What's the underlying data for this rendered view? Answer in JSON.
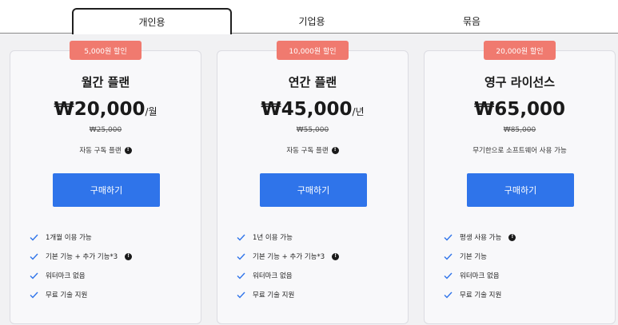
{
  "tabs": [
    {
      "label": "개인용",
      "active": true
    },
    {
      "label": "기업용",
      "active": false
    },
    {
      "label": "묶음",
      "active": false
    }
  ],
  "colors": {
    "accent": "#2f74ea",
    "badge": "#f07a6f"
  },
  "plans": [
    {
      "badge": "5,000원 할인",
      "title": "월간 플랜",
      "price": "₩20,000",
      "period": "/월",
      "old_price": "₩25,000",
      "description": "자동 구독 플랜",
      "buy_label": "구매하기",
      "features": [
        {
          "text": "1개월 이용 가능",
          "info": false
        },
        {
          "text": "기본 기능 + 추가 기능*3",
          "info": true
        },
        {
          "text": "워터마크 없음",
          "info": false
        },
        {
          "text": "무료 기술 지원",
          "info": false
        }
      ]
    },
    {
      "badge": "10,000원 할인",
      "title": "연간 플랜",
      "price": "₩45,000",
      "period": "/년",
      "old_price": "₩55,000",
      "description": "자동 구독 플랜",
      "buy_label": "구매하기",
      "features": [
        {
          "text": "1년 이용 가능",
          "info": false
        },
        {
          "text": "기본 기능 + 추가 기능*3",
          "info": true
        },
        {
          "text": "워터마크 없음",
          "info": false
        },
        {
          "text": "무료 기술 지원",
          "info": false
        }
      ]
    },
    {
      "badge": "20,000원 할인",
      "title": "영구 라이선스",
      "price": "₩65,000",
      "period": "",
      "old_price": "₩85,000",
      "description": "무기한으로 소프트웨어 사용 가능",
      "buy_label": "구매하기",
      "features": [
        {
          "text": "평생 사용 가능",
          "info": true
        },
        {
          "text": "기본 기능",
          "info": false
        },
        {
          "text": "워터마크 없음",
          "info": false
        },
        {
          "text": "무료 기술 지원",
          "info": false
        }
      ]
    }
  ]
}
